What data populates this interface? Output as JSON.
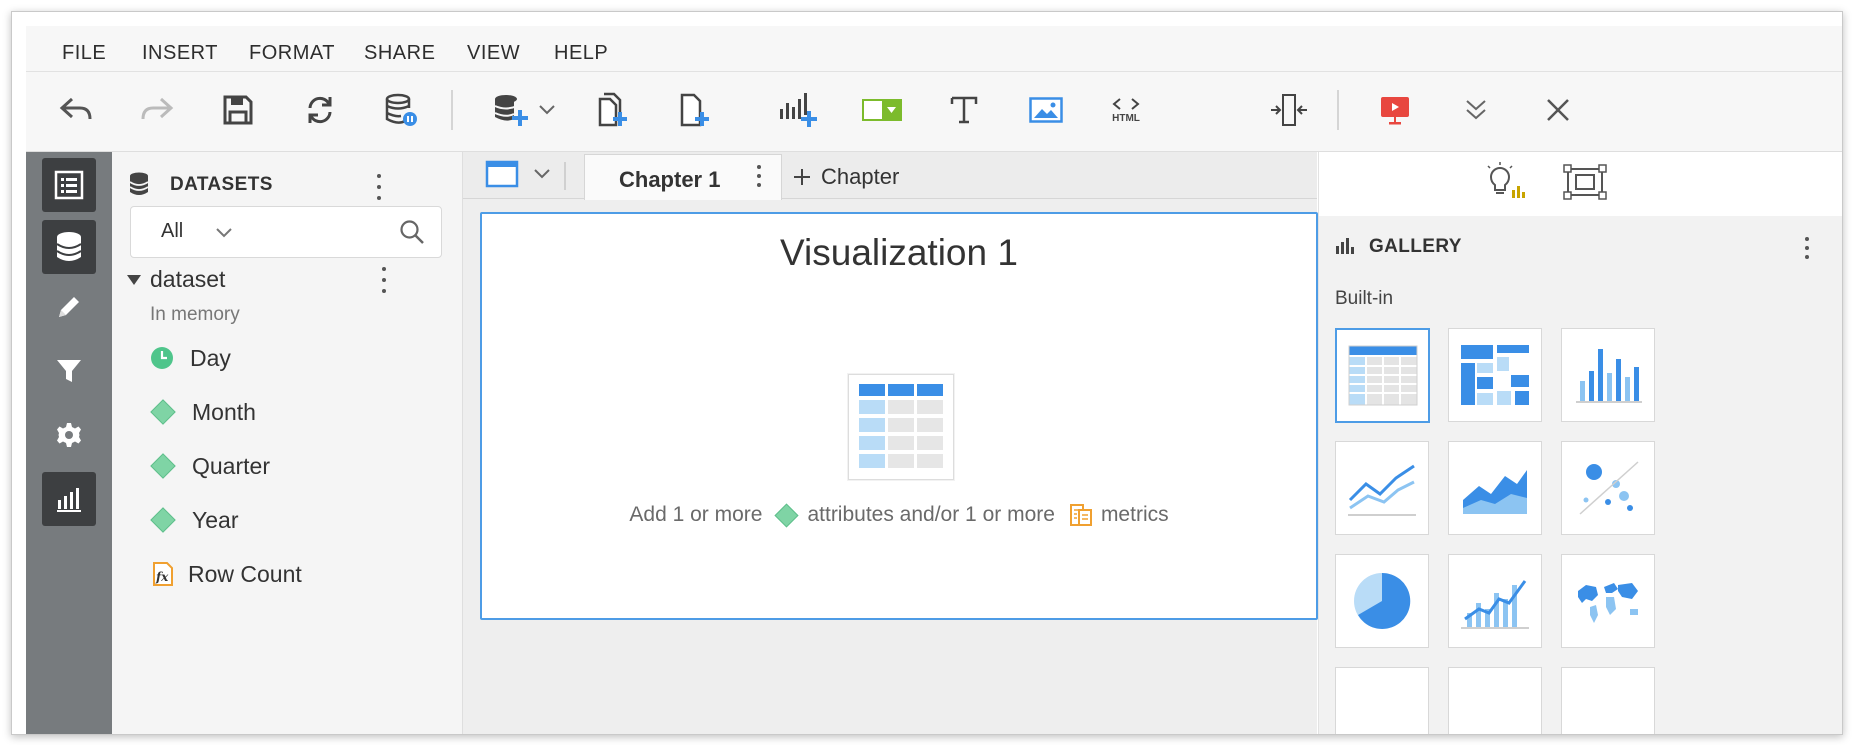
{
  "menu": {
    "items": [
      "FILE",
      "INSERT",
      "FORMAT",
      "SHARE",
      "VIEW",
      "HELP"
    ]
  },
  "toolbar": {
    "html_label": "HTML"
  },
  "datasets_panel": {
    "title": "DATASETS",
    "filter_value": "All",
    "dataset": {
      "name": "dataset",
      "status": "In memory",
      "fields": [
        {
          "label": "Day",
          "type": "date-attribute"
        },
        {
          "label": "Month",
          "type": "attribute"
        },
        {
          "label": "Quarter",
          "type": "attribute"
        },
        {
          "label": "Year",
          "type": "attribute"
        },
        {
          "label": "Row Count",
          "type": "metric"
        }
      ]
    }
  },
  "tabs": {
    "chapter_label": "Chapter 1",
    "add_chapter_label": "Chapter"
  },
  "visualization": {
    "title": "Visualization 1",
    "hint_part1": "Add 1 or more",
    "hint_part2": "attributes and/or 1 or more",
    "hint_part3": "metrics"
  },
  "gallery": {
    "title": "GALLERY",
    "section_label": "Built-in",
    "tiles": [
      "grid",
      "compound-grid",
      "vertical-bar",
      "line",
      "area",
      "bubble",
      "pie",
      "combo-bar-line",
      "map"
    ]
  },
  "colors": {
    "accent": "#4d9ce6",
    "attribute_green": "#7fd4a5",
    "metric_orange": "#f0a030",
    "present_red": "#e8473f",
    "chart_green": "#7cbb2c"
  }
}
